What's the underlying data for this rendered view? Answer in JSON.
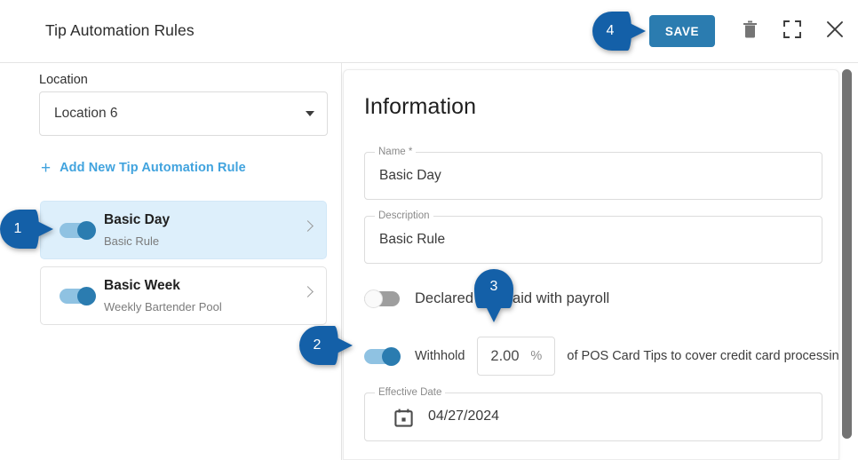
{
  "header": {
    "title": "Tip Automation Rules",
    "save_label": "SAVE",
    "delete_icon": "trash-icon",
    "expand_icon": "fullscreen-icon",
    "close_icon": "close-icon"
  },
  "sidebar": {
    "location_label": "Location",
    "location_value": "Location 6",
    "location_caret_icon": "chevron-down-icon",
    "add_rule_plus": "+",
    "add_rule_label": "Add New Tip Automation Rule",
    "rules": [
      {
        "title": "Basic Day",
        "subtitle": "Basic Rule",
        "enabled": true,
        "selected": true,
        "chevron_icon": "chevron-right-icon"
      },
      {
        "title": "Basic Week",
        "subtitle": "Weekly Bartender Pool",
        "enabled": true,
        "selected": false,
        "chevron_icon": "chevron-right-icon"
      }
    ]
  },
  "information": {
    "heading": "Information",
    "name": {
      "label": "Name *",
      "value": "Basic Day"
    },
    "description": {
      "label": "Description",
      "value": "Basic Rule"
    },
    "declared_tips": {
      "label": "Declared tips paid with payroll",
      "enabled": false
    },
    "withhold": {
      "enabled": true,
      "label": "Withhold",
      "percent_value": "2.00",
      "percent_sign": "%",
      "suffix": "of POS Card Tips to cover credit card processing fees"
    },
    "effective_date": {
      "label": "Effective Date",
      "value": "04/27/2024",
      "calendar_icon": "calendar-icon"
    }
  },
  "markers": [
    {
      "number": "1"
    },
    {
      "number": "2"
    },
    {
      "number": "3"
    },
    {
      "number": "4"
    }
  ],
  "scrollbar": {
    "name": "vertical-scrollbar"
  },
  "colors": {
    "accent_blue": "#2b7cb0",
    "link_blue": "#41a3de",
    "marker_blue": "#1460a8",
    "selected_row_bg": "#ddeffb"
  }
}
